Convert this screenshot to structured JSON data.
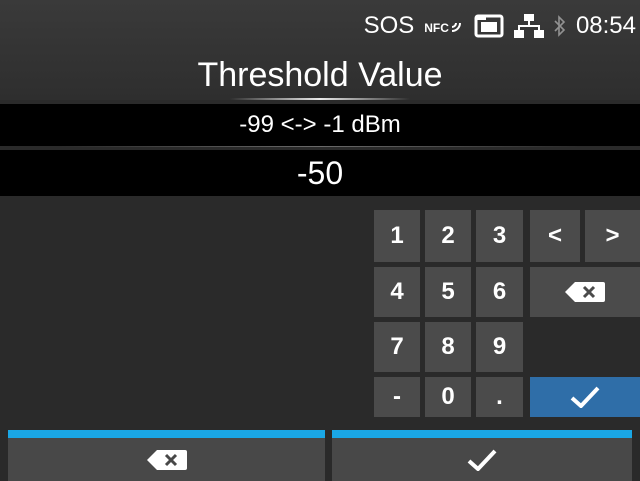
{
  "status_bar": {
    "sos_label": "SOS",
    "nfc_label": "NFC",
    "icons": [
      "nfc-icon",
      "sd-card-icon",
      "network-icon",
      "bluetooth-icon"
    ],
    "time": "08:54"
  },
  "header": {
    "title": "Threshold Value"
  },
  "range": {
    "text": "-99 <-> -1 dBm"
  },
  "value": {
    "current": "-50"
  },
  "keypad": {
    "keys": {
      "k1": "1",
      "k2": "2",
      "k3": "3",
      "k4": "4",
      "k5": "5",
      "k6": "6",
      "k7": "7",
      "k8": "8",
      "k9": "9",
      "minus": "-",
      "k0": "0",
      "dot": ".",
      "left": "<",
      "right": ">"
    },
    "icons": {
      "backspace": "backspace-icon",
      "ok": "checkmark-icon"
    }
  },
  "bottom_bar": {
    "left_icon": "backspace-icon",
    "right_icon": "checkmark-icon"
  },
  "colors": {
    "accent_blue": "#1aa7e6",
    "ok_key": "#2f6ea8",
    "key": "#4b4b4b"
  }
}
